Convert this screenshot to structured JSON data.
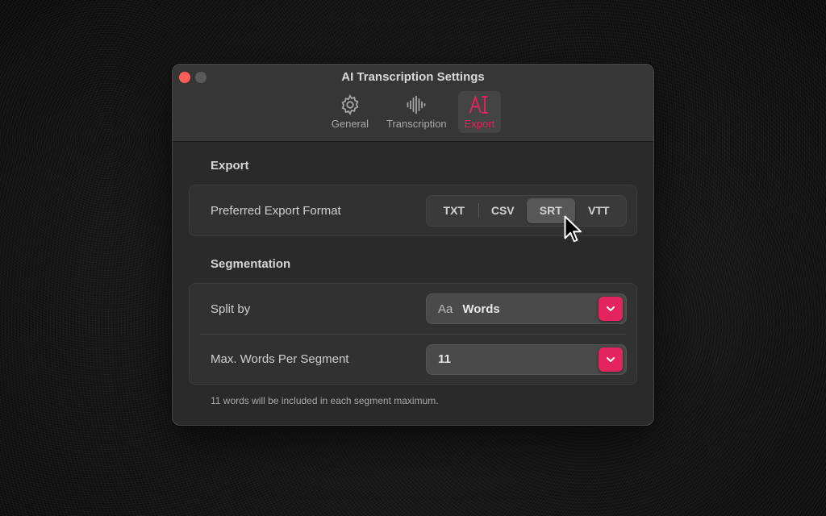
{
  "window": {
    "title": "AI Transcription Settings",
    "tabs": [
      {
        "label": "General",
        "icon": "gear-icon",
        "active": false
      },
      {
        "label": "Transcription",
        "icon": "waveform-icon",
        "active": false
      },
      {
        "label": "Export",
        "icon": "text-cursor-icon",
        "active": true
      }
    ]
  },
  "export_section": {
    "title": "Export",
    "preferred_format_label": "Preferred Export Format",
    "formats": [
      "TXT",
      "CSV",
      "SRT",
      "VTT"
    ],
    "selected_format": "SRT"
  },
  "segmentation_section": {
    "title": "Segmentation",
    "split_by_label": "Split by",
    "split_by_prefix": "Aa",
    "split_by_value": "Words",
    "max_words_label": "Max. Words Per Segment",
    "max_words_value": "11",
    "hint": "11 words will be included in each segment maximum."
  },
  "colors": {
    "accent": "#e3245f",
    "close_button": "#ff5f57"
  }
}
